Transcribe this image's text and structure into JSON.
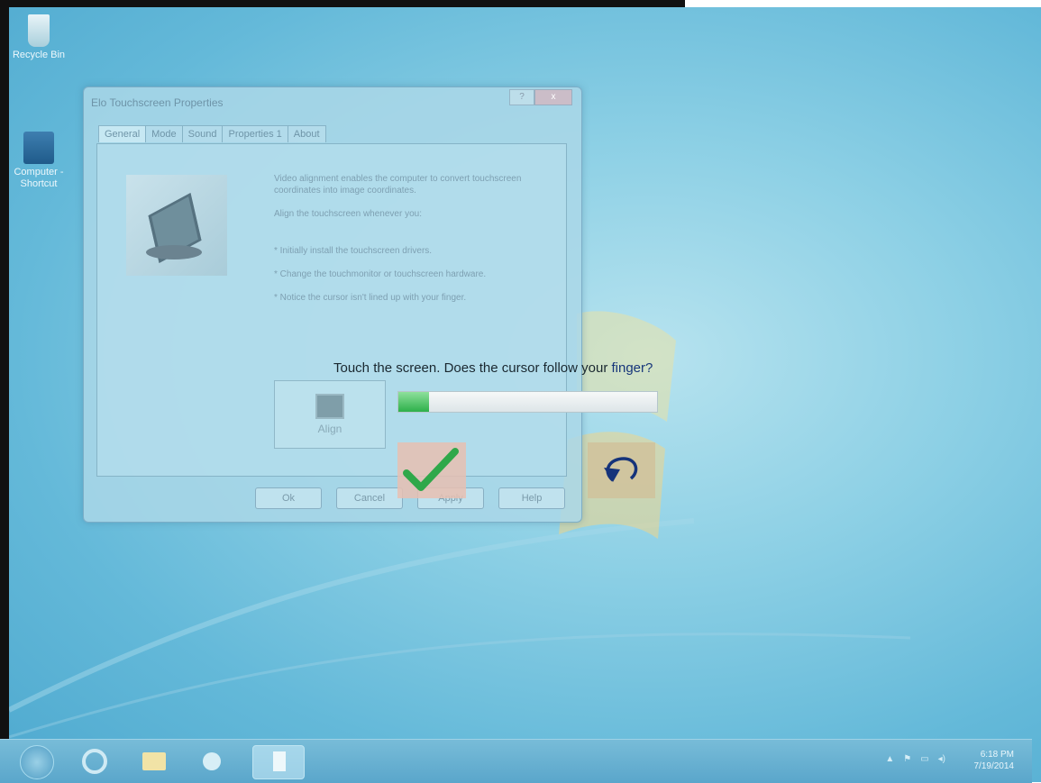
{
  "desktop": {
    "icons": [
      {
        "label": "Recycle Bin",
        "icon": "recycle-bin-icon"
      },
      {
        "label": "Computer - Shortcut",
        "icon": "computer-icon"
      }
    ]
  },
  "dialog": {
    "title": "Elo Touchscreen Properties",
    "title_buttons": [
      "?",
      "x"
    ],
    "tabs": [
      {
        "label": "General",
        "active": true
      },
      {
        "label": "Mode"
      },
      {
        "label": "Sound"
      },
      {
        "label": "Properties 1"
      },
      {
        "label": "About"
      }
    ],
    "description": [
      "Video alignment enables the computer to convert touchscreen coordinates into image coordinates.",
      "Align the touchscreen whenever you:",
      "* Initially install the touchscreen drivers.",
      "* Change the touchmonitor or touchscreen hardware.",
      "* Notice the cursor isn't lined up with your finger."
    ],
    "align_button": "Align",
    "buttons": {
      "ok": "Ok",
      "cancel": "Cancel",
      "apply": "Apply",
      "help": "Help"
    }
  },
  "calibration": {
    "prompt_part1": "Touch the screen. Does the cursor follow your ",
    "prompt_part2": "finger?",
    "progress_fraction": 0.12,
    "accept_icon": "checkmark-icon",
    "undo_icon": "undo-icon"
  },
  "taskbar": {
    "items": [
      "start-orb",
      "internet-explorer-icon",
      "file-explorer-icon",
      "media-player-icon",
      "document-icon"
    ],
    "clock_time": "6:18 PM",
    "clock_date": "7/19/2014"
  },
  "colors": {
    "desktop": "#64b9d9",
    "progress_fill": "#2db04a",
    "check": "#2fa84a",
    "undo": "#15337a"
  }
}
